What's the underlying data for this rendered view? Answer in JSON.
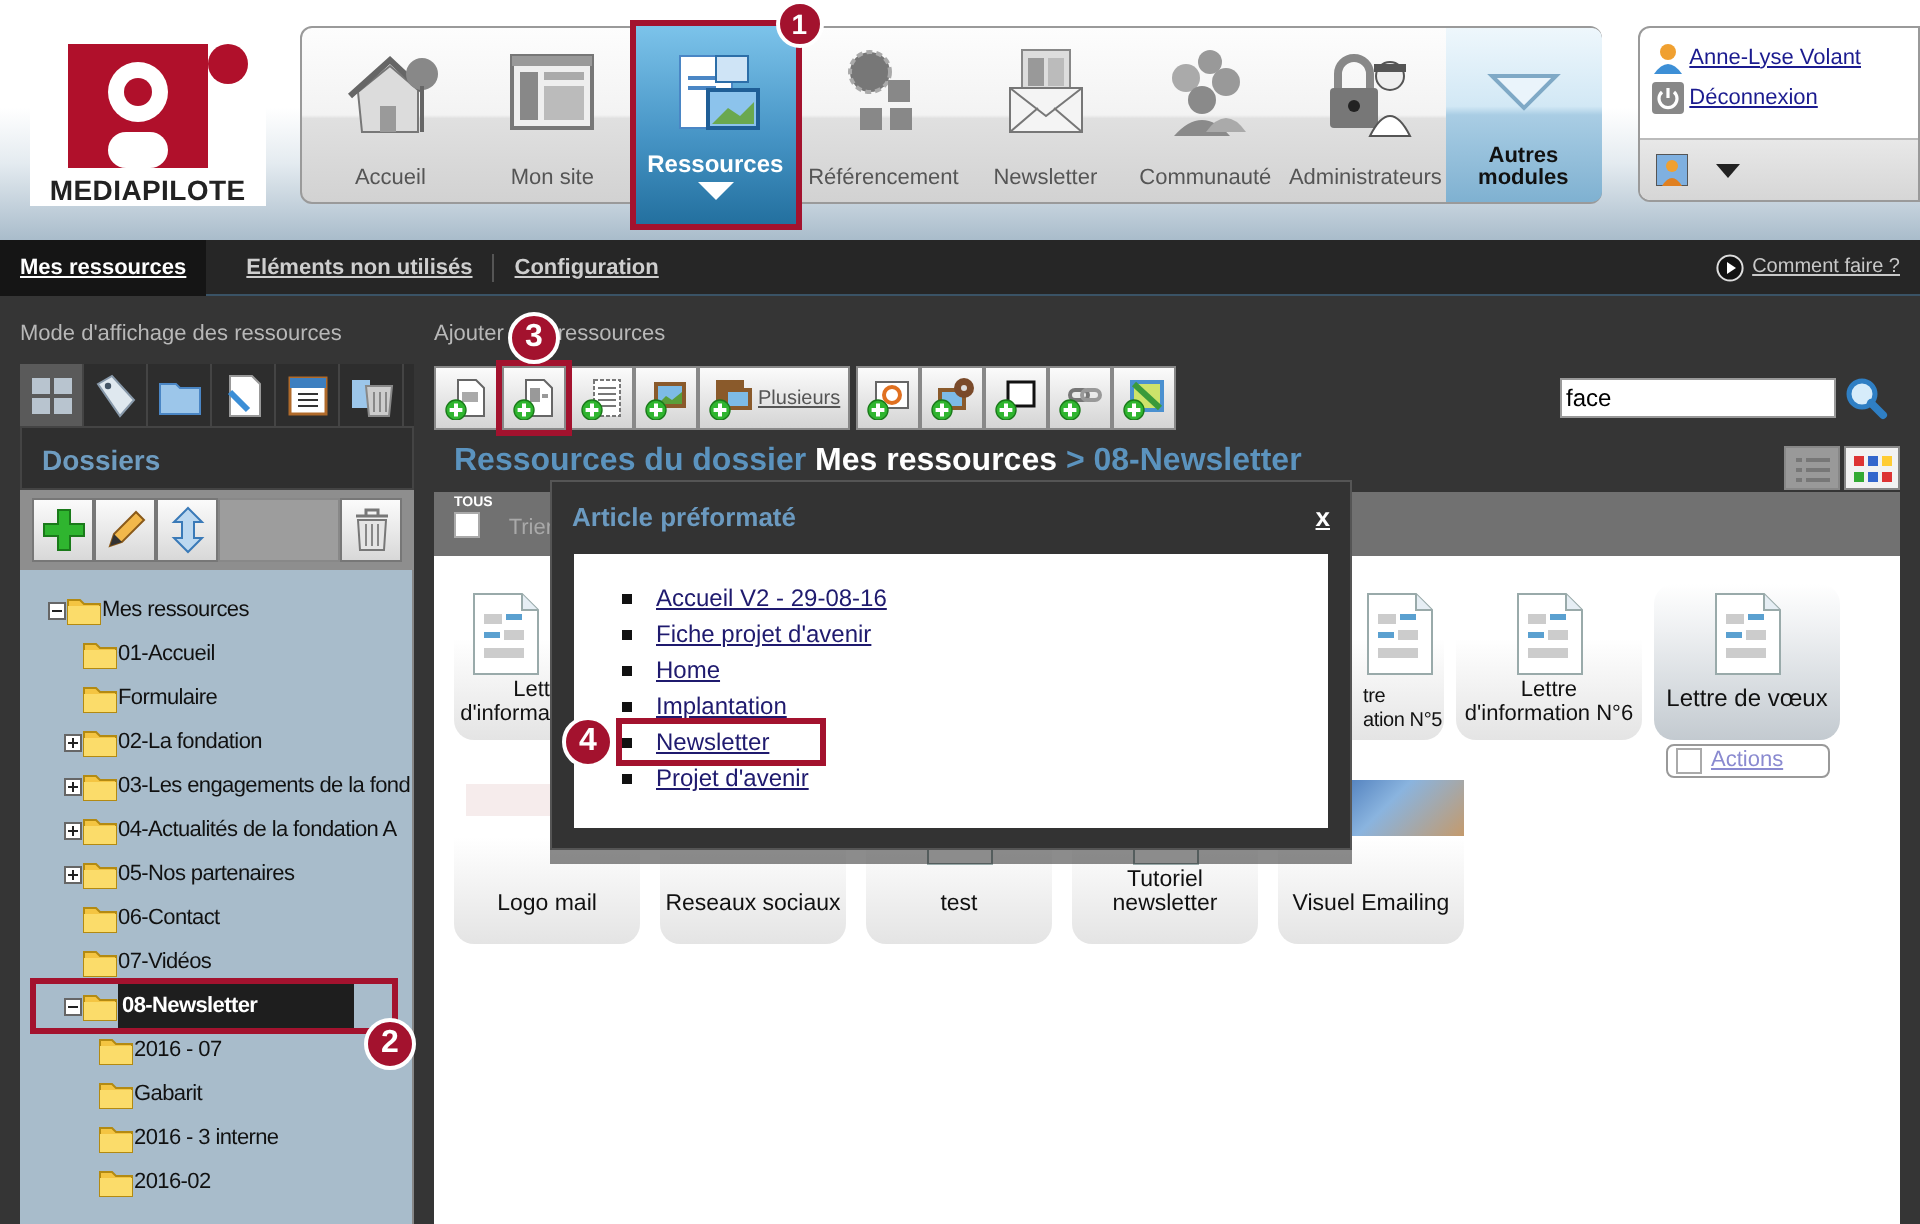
{
  "logo": {
    "text": "MEDIAPILOTE"
  },
  "main_nav": [
    {
      "label": "Accueil",
      "kind": "home",
      "selected": false
    },
    {
      "label": "Mon site",
      "kind": "site",
      "selected": false
    },
    {
      "label": "Ressources",
      "kind": "resources",
      "selected": true,
      "callout": {
        "number": "1"
      }
    },
    {
      "label": "Référencement",
      "kind": "seo",
      "selected": false
    },
    {
      "label": "Newsletter",
      "kind": "newsletter",
      "selected": false
    },
    {
      "label": "Communauté",
      "kind": "community",
      "selected": false
    },
    {
      "label": "Administrateurs",
      "kind": "admin",
      "selected": false
    },
    {
      "label": "Autres modules",
      "kind": "more",
      "selected": false
    }
  ],
  "user_menu": {
    "name": "Anne-Lyse Volant",
    "logout": "Déconnexion"
  },
  "tabs": [
    {
      "label": "Mes ressources",
      "selected": true
    },
    {
      "label": "Eléments non utilisés",
      "selected": false
    },
    {
      "label": "Configuration",
      "selected": false
    }
  ],
  "help_link": "Comment faire ?",
  "sidebar": {
    "view_mode_label": "Mode d'affichage des ressources",
    "view_modes": [
      {
        "kind": "grid",
        "selected": true
      },
      {
        "kind": "tag",
        "selected": false
      },
      {
        "kind": "folder",
        "selected": false
      },
      {
        "kind": "edit",
        "selected": false
      },
      {
        "kind": "calendar",
        "selected": false
      },
      {
        "kind": "trash",
        "selected": false
      }
    ],
    "title": "Dossiers",
    "tree": [
      {
        "label": "Mes ressources",
        "expanded": true,
        "selected": false,
        "children": [
          {
            "label": "01-Accueil",
            "selected": false
          },
          {
            "label": "Formulaire",
            "selected": false
          },
          {
            "label": "02-La fondation",
            "expanded": false,
            "selected": false
          },
          {
            "label": "03-Les engagements de la fond",
            "expanded": false,
            "selected": false
          },
          {
            "label": "04-Actualités de la fondation A",
            "expanded": false,
            "selected": false
          },
          {
            "label": "05-Nos partenaires",
            "expanded": false,
            "selected": false
          },
          {
            "label": "06-Contact",
            "selected": false
          },
          {
            "label": "07-Vidéos",
            "selected": false
          },
          {
            "label": "08-Newsletter",
            "expanded": true,
            "selected": true,
            "callout": {
              "number": "2"
            },
            "children": [
              {
                "label": "2016 - 07",
                "selected": false
              },
              {
                "label": "Gabarit",
                "selected": false
              },
              {
                "label": "2016 - 3 interne",
                "selected": false
              },
              {
                "label": "2016-02",
                "selected": false
              }
            ]
          }
        ]
      }
    ]
  },
  "add_resources": {
    "label_parts": [
      "Ajouter",
      "ressources"
    ],
    "buttons": [
      {
        "kind": "page"
      },
      {
        "kind": "article",
        "callout": {
          "number": "3"
        }
      },
      {
        "kind": "text"
      },
      {
        "kind": "image"
      },
      {
        "kind": "images",
        "label": "Plusieurs"
      },
      {
        "kind": "slideshow"
      },
      {
        "kind": "media"
      },
      {
        "kind": "frame"
      },
      {
        "kind": "link"
      },
      {
        "kind": "map"
      }
    ]
  },
  "search": {
    "value": "face"
  },
  "heading": {
    "parts": [
      {
        "text": "Ressources du dossier",
        "kind": "path"
      },
      {
        "text": "Mes ressources",
        "kind": "root"
      },
      {
        "text": "> 08-Newsletter",
        "kind": "path"
      }
    ]
  },
  "views": [
    {
      "kind": "list",
      "selected": false
    },
    {
      "kind": "grid",
      "selected": true
    }
  ],
  "sort_bar": {
    "all_label": "TOUS",
    "all_checked": false,
    "sort_label": "Trier"
  },
  "tiles_row_1": [
    {
      "lines": [
        "Lett",
        "d'informa"
      ],
      "selected": false
    },
    {
      "lines": [
        "tre",
        "ation N°5"
      ],
      "selected": false
    },
    {
      "lines": [
        "Lettre",
        "d'information N°6"
      ],
      "selected": false
    },
    {
      "lines": [
        "Lettre de vœux"
      ],
      "selected": true,
      "actions": {
        "label": "Actions",
        "checked": false
      }
    }
  ],
  "tiles_row_2": [
    {
      "label": "Logo mail",
      "kind": "logo"
    },
    {
      "label": "Reseaux sociaux"
    },
    {
      "label": "test",
      "kind": "doc"
    },
    {
      "label": "Tutoriel newsletter",
      "kind": "doc"
    },
    {
      "label": "Visuel Emailing",
      "kind": "photo"
    }
  ],
  "popup": {
    "title": "Article préformaté",
    "close": "x",
    "items": [
      {
        "label": "Accueil V2 - 29-08-16"
      },
      {
        "label": "Fiche projet d'avenir"
      },
      {
        "label": "Home"
      },
      {
        "label": "Implantation"
      },
      {
        "label": "Newsletter",
        "callout": {
          "number": "4"
        }
      },
      {
        "label": "Projet d'avenir"
      }
    ]
  }
}
